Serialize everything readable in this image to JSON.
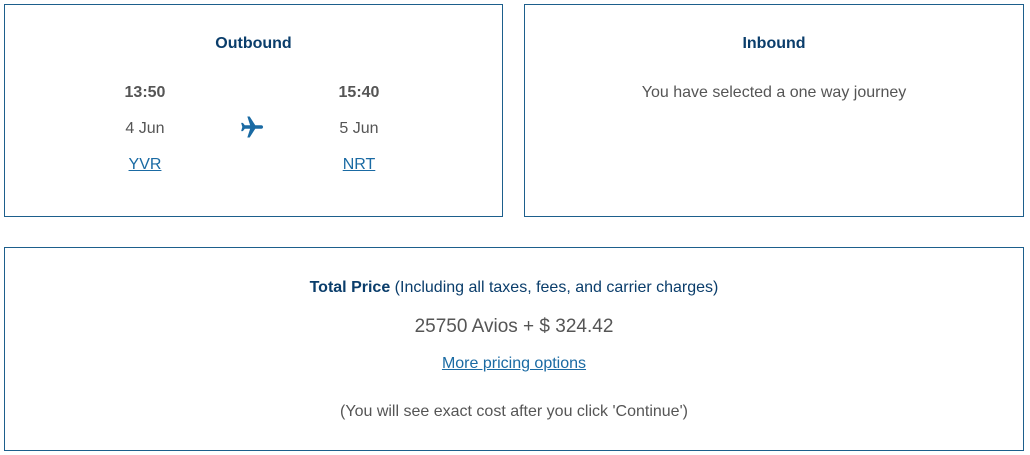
{
  "outbound": {
    "heading": "Outbound",
    "depart_time": "13:50",
    "depart_date": "4 Jun",
    "depart_airport": "YVR",
    "arrive_time": "15:40",
    "arrive_date": "5 Jun",
    "arrive_airport": "NRT",
    "icon": "plane-icon"
  },
  "inbound": {
    "heading": "Inbound",
    "message": "You have selected a one way journey"
  },
  "price": {
    "label": "Total Price",
    "label_note": "(Including all taxes, fees, and carrier charges)",
    "amount": "25750 Avios + $ 324.42",
    "more_options_link": "More pricing options",
    "footnote": "(You will see exact cost after you click 'Continue')"
  },
  "colors": {
    "border": "#1d5f8c",
    "heading": "#0a3d6b",
    "link": "#1a6aa3",
    "text": "#555555"
  }
}
